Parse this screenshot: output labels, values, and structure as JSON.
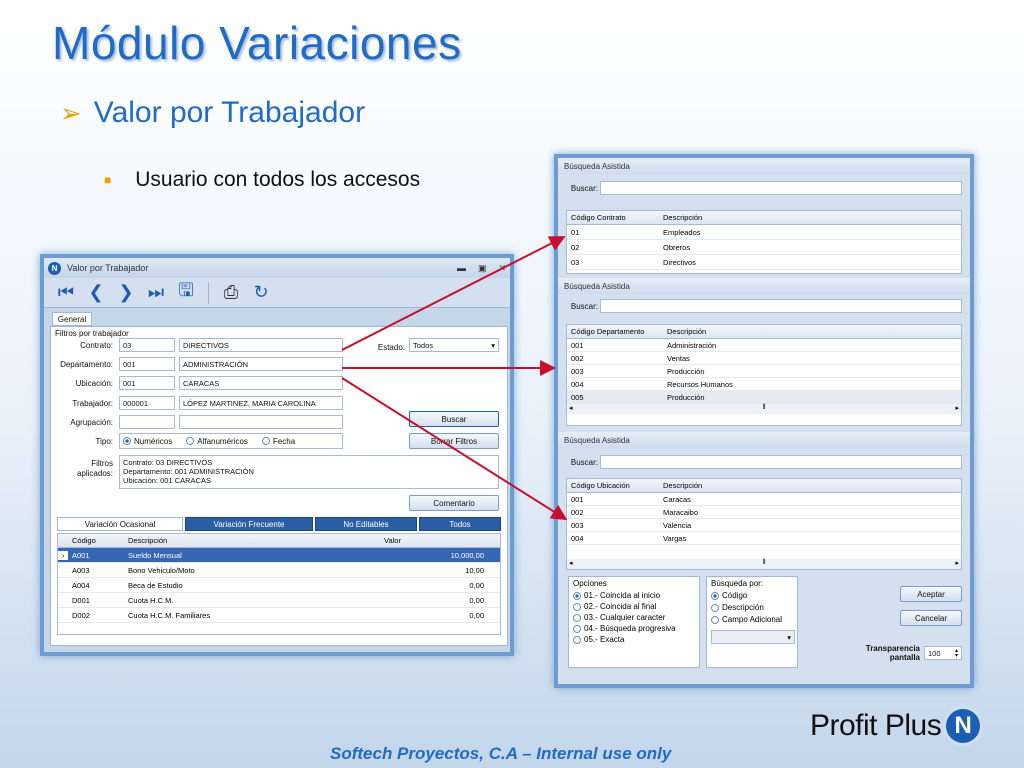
{
  "slide": {
    "title": "Módulo Variaciones",
    "subtitle": "Valor por Trabajador",
    "bullet": "Usuario con todos los accesos",
    "footer": "Softech Proyectos, C.A – Internal use only",
    "logo_text": "Profit Plus",
    "logo_badge": "N"
  },
  "colors": {
    "accent": "#1f6bc7",
    "bullet": "#e8a300",
    "arrow": "#c8102e",
    "selected_row": "#3567b5"
  },
  "main_window": {
    "title": "Valor por Trabajador",
    "title_icon": "N",
    "general_tab": "General",
    "filters_title": "Filtros por trabajador",
    "labels": {
      "contrato": "Contrato:",
      "departamento": "Departamento:",
      "ubicacion": "Ubicación:",
      "trabajador": "Trabajador:",
      "agrupacion": "Agrupación:",
      "tipo": "Tipo:",
      "estado": "Estado:",
      "filtros_aplicados": "Filtros aplicados:"
    },
    "values": {
      "contrato_code": "03",
      "contrato_desc": "DIRECTIVOS",
      "departamento_code": "001",
      "departamento_desc": "ADMINISTRACIÓN",
      "ubicacion_code": "001",
      "ubicacion_desc": "CARACAS",
      "trabajador_code": "000001",
      "trabajador_desc": "LÓPEZ MARTINEZ, MARIA CAROLINA",
      "estado": "Todos"
    },
    "tipo_options": [
      "Numéricos",
      "Alfanuméricos",
      "Fecha"
    ],
    "buttons": {
      "buscar": "Buscar",
      "borrar": "Borrar Filtros",
      "comentario": "Comentario"
    },
    "applied_filters": [
      "Contrato: 03 DIRECTIVOS",
      "Departamento: 001 ADMINISTRACIÓN",
      "Ubicación: 001 CARACAS"
    ],
    "tabs": [
      "Variación Ocasional",
      "Variación Frecuente",
      "No Editables",
      "Todos"
    ],
    "grid": {
      "headers": [
        "Código",
        "Descripción",
        "Valor"
      ],
      "rows": [
        [
          "A001",
          "Sueldo Mensual",
          "10.000,00"
        ],
        [
          "A003",
          "Bono Vehiculo/Moto",
          "10,00"
        ],
        [
          "A004",
          "Beca de Estudio",
          "0,00"
        ],
        [
          "D001",
          "Cuota H.C.M.",
          "0,00"
        ],
        [
          "D002",
          "Cuota H.C.M. Familiares",
          "0,00"
        ]
      ]
    }
  },
  "search_window": {
    "panel_title": "Búsqueda Asistida",
    "buscar_label": "Buscar:",
    "contrato": {
      "headers": [
        "Código Contrato",
        "Descripción"
      ],
      "rows": [
        [
          "01",
          "Empleados"
        ],
        [
          "02",
          "Obreros"
        ],
        [
          "03",
          "Directivos"
        ]
      ]
    },
    "departamento": {
      "headers": [
        "Código Departamento",
        "Descripción"
      ],
      "rows": [
        [
          "001",
          "Administración"
        ],
        [
          "002",
          "Ventas"
        ],
        [
          "003",
          "Producción"
        ],
        [
          "004",
          "Recursos Humanos"
        ],
        [
          "005",
          "Producción"
        ]
      ]
    },
    "ubicacion": {
      "headers": [
        "Código Ubicación",
        "Descripción"
      ],
      "rows": [
        [
          "001",
          "Caracas"
        ],
        [
          "002",
          "Maracaibo"
        ],
        [
          "003",
          "Valencia"
        ],
        [
          "004",
          "Vargas"
        ]
      ]
    },
    "opciones_title": "Opciones",
    "opciones": [
      "01.- Coincida al inicio",
      "02.- Coincida al final",
      "03.- Cualquier caracter",
      "04.- Búsqueda progresiva",
      "05.- Exacta"
    ],
    "busqueda_por_title": "Búsqueda por:",
    "busqueda_por": [
      "Código",
      "Descripción",
      "Campo Adicional"
    ],
    "aceptar": "Aceptar",
    "cancelar": "Cancelar",
    "transparencia_label": "Transparencia pantalla",
    "transparencia_value": "100"
  }
}
